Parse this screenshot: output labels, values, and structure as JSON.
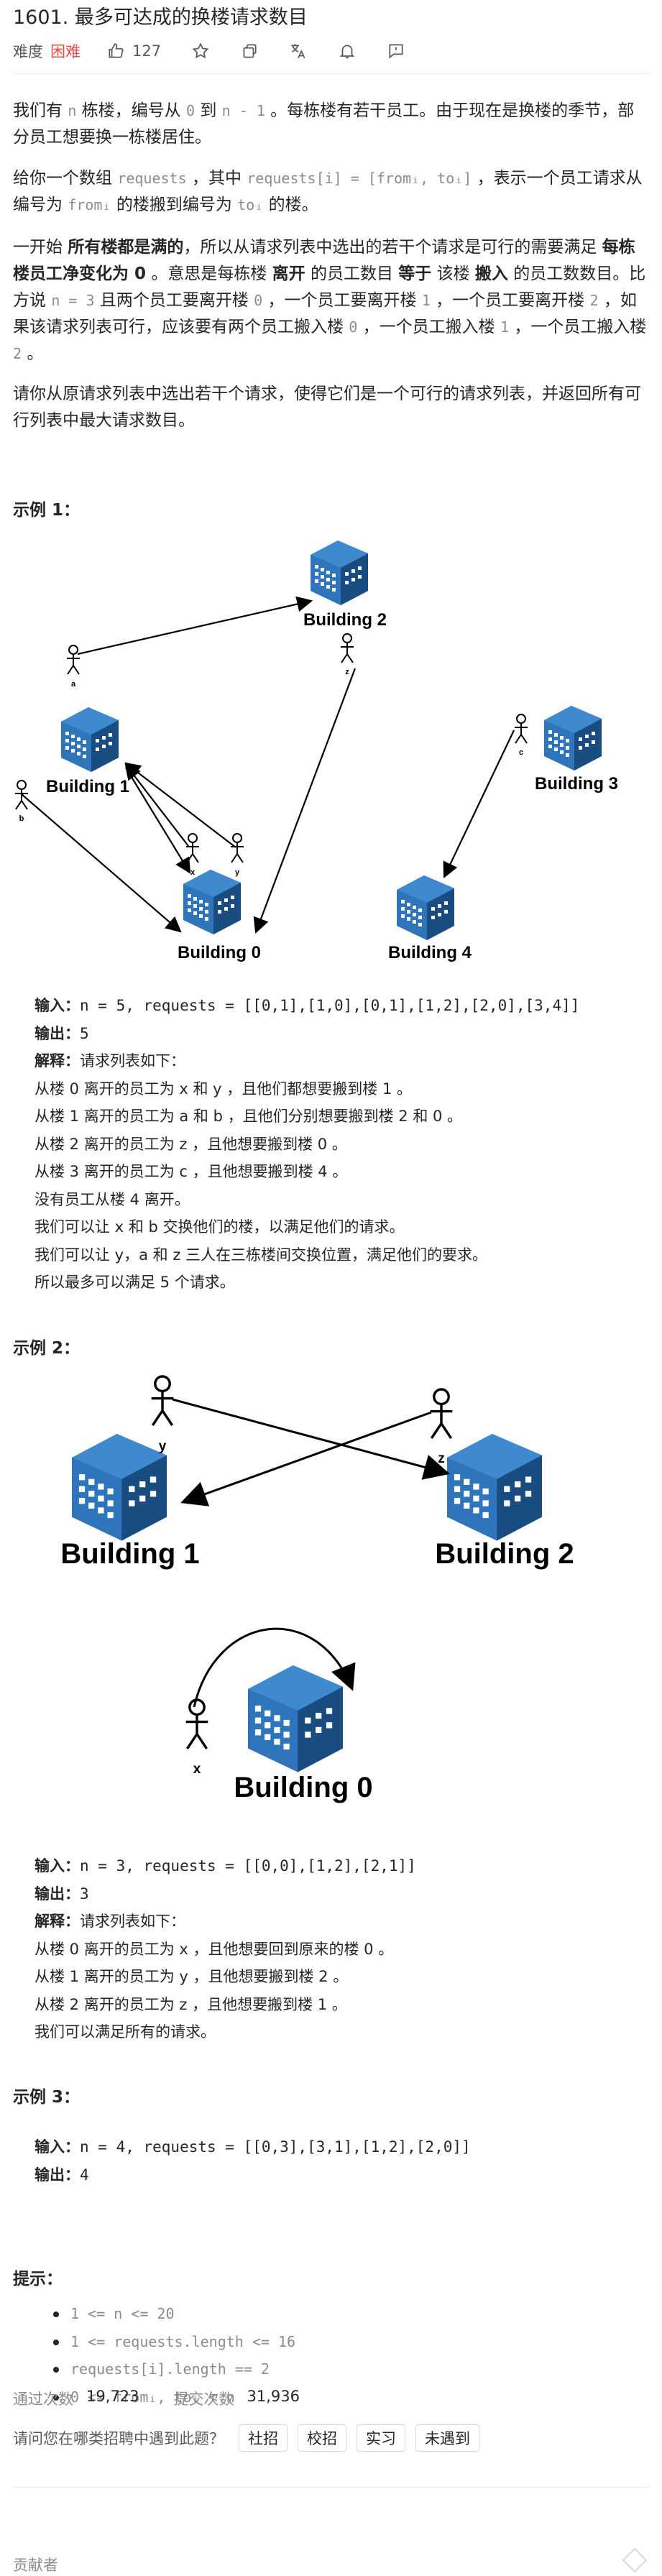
{
  "header": {
    "title": "1601. 最多可达成的换楼请求数目"
  },
  "meta": {
    "difficulty_label": "难度",
    "difficulty_value": "困难",
    "likes": "127"
  },
  "description": {
    "p1": [
      "我们有 ",
      "n",
      " 栋楼，编号从 ",
      "0",
      " 到 ",
      "n - 1",
      " 。每栋楼有若干员工。由于现在是换楼的季节，部分员工想要换一栋楼居住。"
    ],
    "p2": [
      "给你一个数组 ",
      "requests",
      " ，其中 ",
      "requests[i] = [fromᵢ, toᵢ]",
      " ，表示一个员工请求从编号为 ",
      "fromᵢ",
      " 的楼搬到编号为 ",
      "toᵢ",
      " 的楼。"
    ],
    "p3": [
      "一开始 ",
      "所有楼都是满的",
      "，所以从请求列表中选出的若干个请求是可行的需要满足 ",
      "每栋楼员工净变化为 0",
      " 。意思是每栋楼 ",
      "离开",
      " 的员工数目 ",
      "等于",
      " 该楼 ",
      "搬入",
      " 的员工数数目。比方说 ",
      "n = 3",
      " 且两个员工要离开楼 ",
      "0",
      " ，一个员工要离开楼 ",
      "1",
      " ，一个员工要离开楼 ",
      "2",
      " ，如果该请求列表可行，应该要有两个员工搬入楼 ",
      "0",
      " ，一个员工搬入楼 ",
      "1",
      " ，一个员工搬入楼 ",
      "2",
      " 。"
    ],
    "p4": "请你从原请求列表中选出若干个请求，使得它们是一个可行的请求列表，并返回所有可行列表中最大请求数目。"
  },
  "example1": {
    "title": "示例 1：",
    "figure": {
      "buildings": [
        "Building 0",
        "Building 1",
        "Building 2",
        "Building 3",
        "Building 4"
      ],
      "people": [
        "a",
        "b",
        "x",
        "y",
        "z",
        "c"
      ]
    },
    "input_label": "输入：",
    "input_value": "n = 5, requests = [[0,1],[1,0],[0,1],[1,2],[2,0],[3,4]]",
    "output_label": "输出：",
    "output_value": "5",
    "explain_label": "解释：",
    "explain_value": "请求列表如下：",
    "lines": [
      "从楼 0 离开的员工为 x 和 y ，且他们都想要搬到楼 1 。",
      "从楼 1 离开的员工为 a 和 b ，且他们分别想要搬到楼 2 和 0 。",
      "从楼 2 离开的员工为 z ，且他想要搬到楼 0 。",
      "从楼 3 离开的员工为 c ，且他想要搬到楼 4 。",
      "没有员工从楼 4 离开。",
      "我们可以让 x 和 b 交换他们的楼，以满足他们的请求。",
      "我们可以让 y，a 和 z 三人在三栋楼间交换位置，满足他们的要求。",
      "所以最多可以满足 5 个请求。"
    ]
  },
  "example2": {
    "title": "示例 2：",
    "figure": {
      "buildings": [
        "Building 1",
        "Building 2",
        "Building 0"
      ],
      "people": [
        "y",
        "z",
        "x"
      ]
    },
    "input_label": "输入：",
    "input_value": "n = 3, requests = [[0,0],[1,2],[2,1]]",
    "output_label": "输出：",
    "output_value": "3",
    "explain_label": "解释：",
    "explain_value": "请求列表如下：",
    "lines": [
      "从楼 0 离开的员工为 x ，且他想要回到原来的楼 0 。",
      "从楼 1 离开的员工为 y ，且他想要搬到楼 2 。",
      "从楼 2 离开的员工为 z ，且他想要搬到楼 1 。",
      "我们可以满足所有的请求。"
    ]
  },
  "example3": {
    "title": "示例 3：",
    "input_label": "输入：",
    "input_value": "n = 4, requests = [[0,3],[3,1],[1,2],[2,0]]",
    "output_label": "输出：",
    "output_value": "4"
  },
  "hints": {
    "title": "提示：",
    "items": [
      "1 <= n <= 20",
      "1 <= requests.length <= 16",
      "requests[i].length == 2",
      "0 <= fromᵢ, toᵢ < n"
    ]
  },
  "stats": {
    "accepted_label": "通过次数",
    "accepted_value": "19,723",
    "submitted_label": "提交次数",
    "submitted_value": "31,936"
  },
  "survey": {
    "question": "请问您在哪类招聘中遇到此题？",
    "options": [
      "社招",
      "校招",
      "实习",
      "未遇到"
    ]
  },
  "contributors_label": "贡献者",
  "colors": {
    "hard": "#ef4743",
    "building": "#2a6db0",
    "text": "#262626",
    "muted": "#8c8c8c"
  }
}
